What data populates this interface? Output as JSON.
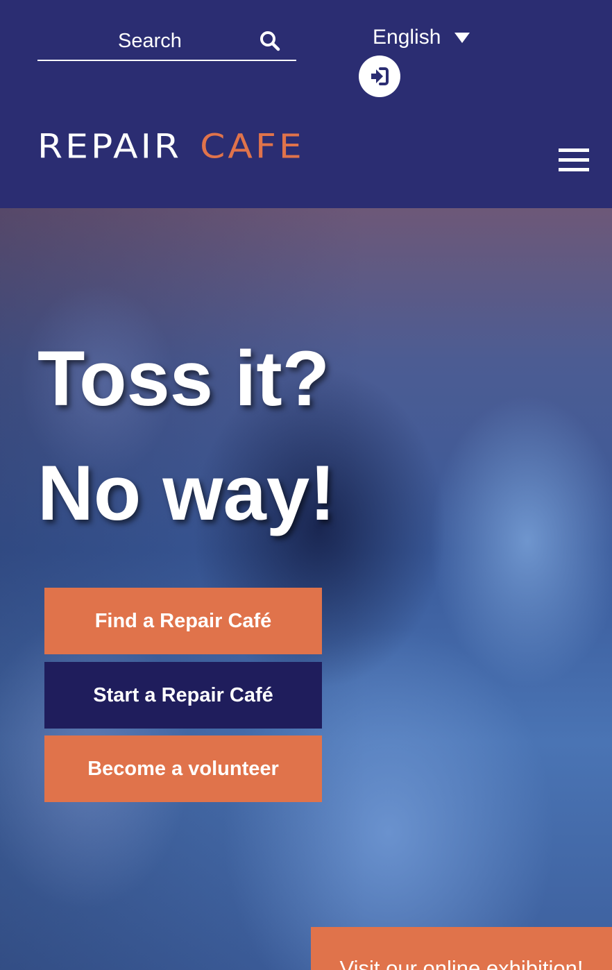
{
  "header": {
    "search": {
      "placeholder": "Search",
      "icon": "search-icon"
    },
    "language": {
      "selected": "English",
      "icon": "caret-down-icon"
    },
    "login": {
      "icon": "sign-in-icon"
    },
    "logo": {
      "word1": "REPAIR",
      "word2": "CAFE"
    },
    "menu": {
      "icon": "hamburger-menu-icon"
    }
  },
  "hero": {
    "headline_line1": "Toss it?",
    "headline_line2": "No way!",
    "buttons": [
      {
        "label": "Find a Repair Café"
      },
      {
        "label": "Start a Repair Café"
      },
      {
        "label": "Become a volunteer"
      }
    ],
    "exhibition_banner": "Visit our online exhibition!"
  },
  "colors": {
    "header_bg": "#2b2d72",
    "accent_orange": "#e0734b",
    "dark_navy_button": "#1f1d5c",
    "text_white": "#ffffff"
  }
}
